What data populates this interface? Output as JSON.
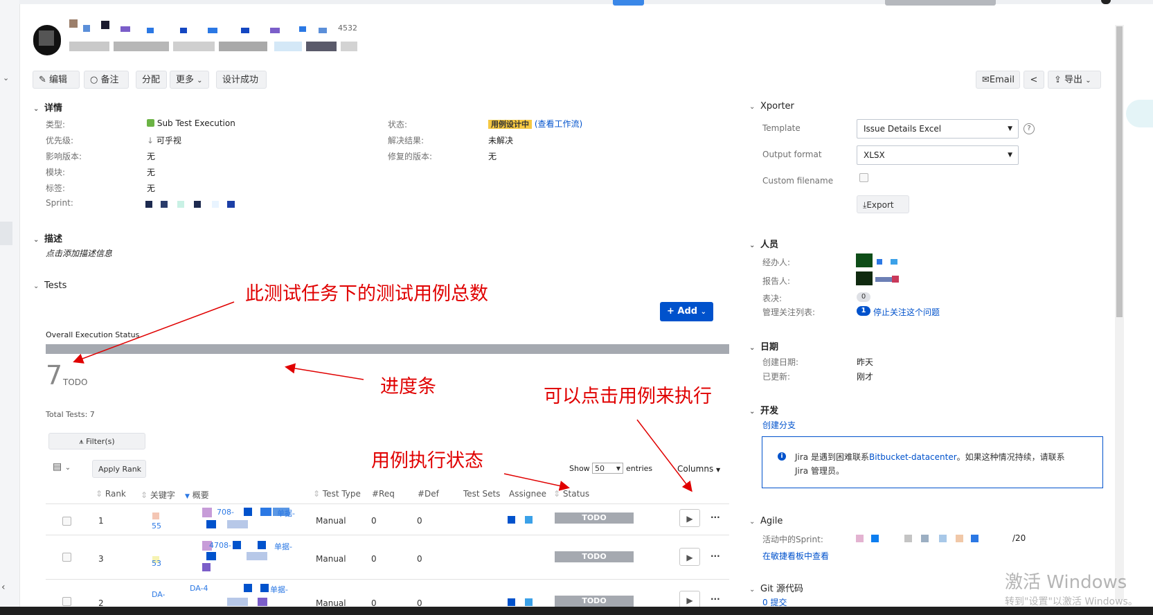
{
  "toolbar": {
    "edit": "编辑",
    "comment": "备注",
    "assign": "分配",
    "more": "更多",
    "design_done": "设计成功",
    "email": "Email",
    "export": "导出"
  },
  "header": {
    "id_suffix": "4532"
  },
  "details": {
    "title": "详情",
    "type_label": "类型:",
    "type_value": "Sub Test Execution",
    "priority_label": "优先级:",
    "priority_value": "可乎视",
    "affects_label": "影响版本:",
    "affects_value": "无",
    "component_label": "模块:",
    "component_value": "无",
    "labels_label": "标签:",
    "labels_value": "无",
    "sprint_label": "Sprint:",
    "status_label": "状态:",
    "status_value": "用例设计中",
    "view_workflow": "(查看工作流)",
    "resolution_label": "解决结果:",
    "resolution_value": "未解决",
    "fix_label": "修复的版本:",
    "fix_value": "无"
  },
  "description": {
    "title": "描述",
    "placeholder": "点击添加描述信息"
  },
  "tests": {
    "title": "Tests",
    "add_label": "Add",
    "overall_status": "Overall Execution Status",
    "progress": {
      "todo_fraction": 1.0
    },
    "count": "7",
    "count_label": "TODO",
    "total": "Total Tests: 7",
    "filters": "Filter(s)",
    "apply_rank": "Apply Rank",
    "show": "Show",
    "entries_value": "50",
    "entries": "entries",
    "columns": "Columns",
    "headers": [
      "Rank",
      "关键字",
      "概要",
      "Test Type",
      "#Req",
      "#Def",
      "Test Sets",
      "Assignee",
      "Status"
    ],
    "rows": [
      {
        "rank": "1",
        "key": "55",
        "summary1": "708-",
        "summary2": "单据-",
        "type": "Manual",
        "req": "0",
        "def": "0",
        "status": "TODO"
      },
      {
        "rank": "3",
        "key": "53",
        "summary1": "4708-",
        "summary2": "单据-",
        "type": "Manual",
        "req": "0",
        "def": "0",
        "status": "TODO"
      },
      {
        "rank": "2",
        "key": "DA-",
        "summary1": "DA-4",
        "summary2": "单据-",
        "type": "Manual",
        "req": "0",
        "def": "0",
        "status": "TODO"
      }
    ]
  },
  "annotations": {
    "total": "此测试任务下的测试用例总数",
    "progress": "进度条",
    "clickable": "可以点击用例来执行",
    "status": "用例执行状态"
  },
  "xporter": {
    "title": "Xporter",
    "template_label": "Template",
    "template_value": "Issue Details Excel",
    "format_label": "Output format",
    "format_value": "XLSX",
    "filename_label": "Custom filename",
    "export_btn": "Export"
  },
  "people": {
    "title": "人员",
    "assignee_label": "经办人:",
    "reporter_label": "报告人:",
    "votes_label": "表决:",
    "votes_value": "0",
    "watchers_label": "管理关注列表:",
    "watchers_value": "1",
    "stop_watch": "停止关注这个问题"
  },
  "dates": {
    "title": "日期",
    "created_label": "创建日期:",
    "created_value": "昨天",
    "updated_label": "已更新:",
    "updated_value": "刚才"
  },
  "dev": {
    "title": "开发",
    "create_branch": "创建分支",
    "jira_prefix": "Jira 是遇到困难联系",
    "jira_link": "Bitbucket-datacenter",
    "jira_suffix": "。如果这种情况持续，请联系",
    "jira_line2": "Jira 管理员。"
  },
  "agile": {
    "title": "Agile",
    "active_sprint_label": "活动中的Sprint:",
    "sprint_suffix": "/20",
    "view_board": "在敏捷看板中查看"
  },
  "git": {
    "title": "Git 源代码",
    "commits": "0 提交"
  },
  "watermark": {
    "line1": "激活 Windows",
    "line2": "转到\"设置\"以激活 Windows。"
  },
  "colors": {
    "accent": "#0052cc",
    "status_badge": "#f5c842",
    "todo_gray": "#a5a9b0",
    "annotation_red": "#e00000"
  }
}
